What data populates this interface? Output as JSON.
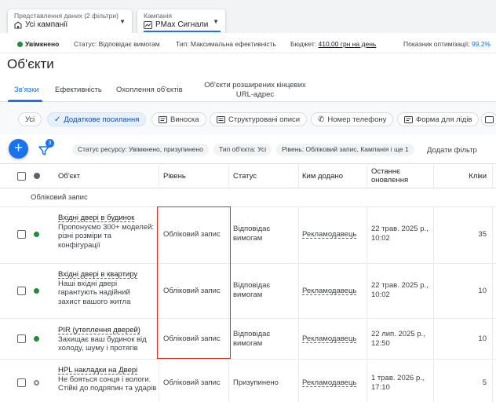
{
  "header": {
    "view_selector": {
      "label": "Представлення даних (2 фільтри)",
      "value": "Усі кампанії",
      "icon": "store-icon"
    },
    "campaign_selector": {
      "label": "Кампанія",
      "value": "PMax Сигнали",
      "icon": "pmax-icon"
    }
  },
  "status_bar": {
    "state": "Увімкнено",
    "status_label": "Статус:",
    "status_value": "Відповідає вимогам",
    "type_label": "Тип:",
    "type_value": "Максимальна ефективність",
    "budget_label": "Бюджет:",
    "budget_value": "410,00 грн на день",
    "score_label": "Показник оптимізації:",
    "score_value": "99,2%",
    "colors": {
      "active": "#1e8e3e",
      "accent": "#1a73e8"
    }
  },
  "page_title": "Об'єкти",
  "tabs": [
    {
      "label": "Зв'язки",
      "active": true
    },
    {
      "label": "Ефективність",
      "active": false
    },
    {
      "label": "Охоплення об'єктів",
      "active": false
    },
    {
      "label": "Об'єкти розширених кінцевих URL-адрес",
      "active": false
    }
  ],
  "chips": [
    {
      "label": "Усі",
      "selected": false,
      "icon": ""
    },
    {
      "label": "Додаткове посилання",
      "selected": true,
      "icon": "check-icon"
    },
    {
      "label": "Виноска",
      "selected": false,
      "icon": "callout-icon"
    },
    {
      "label": "Структуровані описи",
      "selected": false,
      "icon": "list-icon"
    },
    {
      "label": "Номер телефону",
      "selected": false,
      "icon": "phone-icon"
    },
    {
      "label": "Форма для лідів",
      "selected": false,
      "icon": "form-icon"
    }
  ],
  "filters": {
    "count": "3",
    "chips": [
      "Статус ресурсу: Увімкнено, призупинено",
      "Тип об'єкта: Усі",
      "Рівень: Обліковий запис, Кампанія і ще 1"
    ],
    "add_filter": "Додати фільтр"
  },
  "table": {
    "headers": {
      "object": "Об'єкт",
      "level": "Рівень",
      "status": "Статус",
      "added_by": "Ким додано",
      "updated": "Останнє оновлення",
      "clicks": "Кліки"
    },
    "group_label": "Обліковий запис",
    "rows": [
      {
        "status_dot": "green",
        "title": "Вхідні двері в будинок",
        "desc": "Пропонуємо 300+ моделей: різні розміри та конфігурації",
        "level": "Обліковий запис",
        "status": "Відповідає вимогам",
        "added_by": "Рекламодавець",
        "updated": "22 трав. 2025 р., 10:02",
        "clicks": "35"
      },
      {
        "status_dot": "green",
        "title": "Вхідні двері в квартиру",
        "desc": "Наші вхідні двері гарантують надійний захист вашого житла",
        "level": "Обліковий запис",
        "status": "Відповідає вимогам",
        "added_by": "Рекламодавець",
        "updated": "22 трав. 2025 р., 10:02",
        "clicks": "10"
      },
      {
        "status_dot": "green",
        "title": "PIR (утеплення дверей)",
        "desc": "Захищає ваш будинок від холоду, шуму і протягів",
        "level": "Обліковий запис",
        "status": "Відповідає вимогам",
        "added_by": "Рекламодавець",
        "updated": "22 лип. 2025 р., 12:50",
        "clicks": "10"
      },
      {
        "status_dot": "grey",
        "title": "HPL накладки на Двері",
        "desc": "Не бояться сонця і вологи. Стійкі до подряпин та ударів",
        "level": "Обліковий запис",
        "status": "Призупинено",
        "added_by": "Рекламодавець",
        "updated": "1 трав. 2026 р., 17:10",
        "clicks": "5"
      }
    ]
  }
}
